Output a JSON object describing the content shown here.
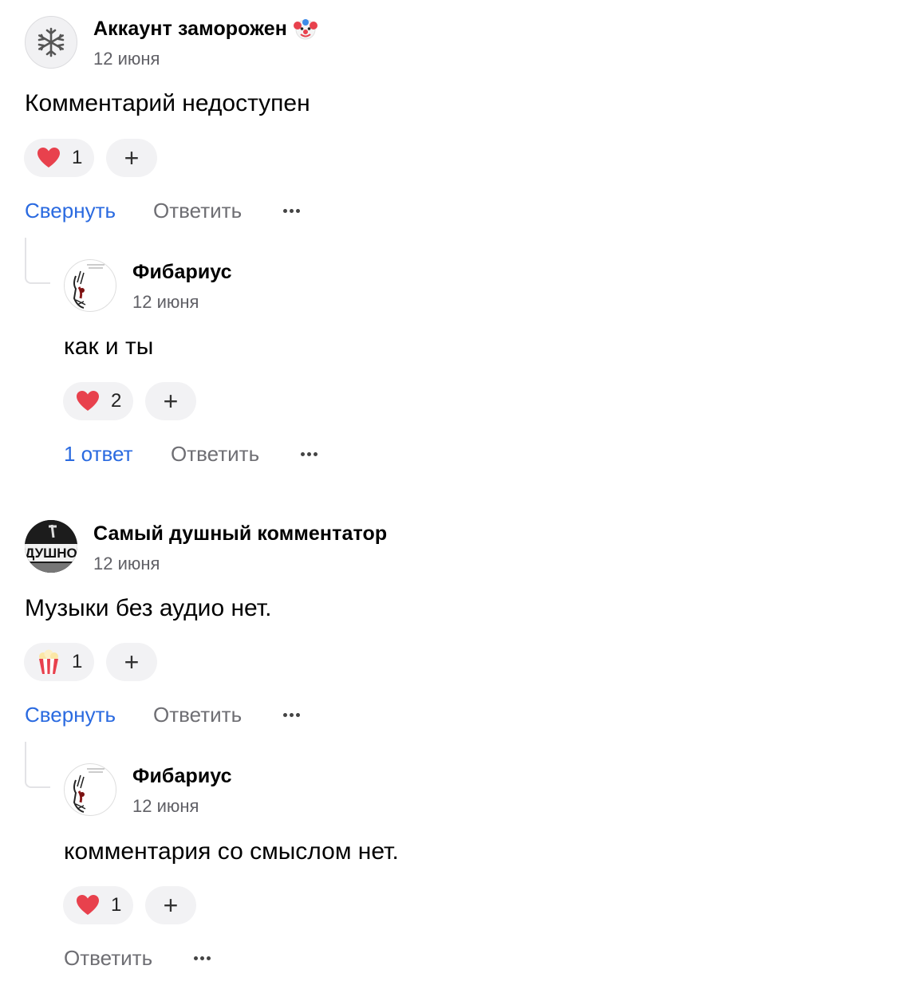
{
  "comments": [
    {
      "author": "Аккаунт заморожен",
      "date": "12 июня",
      "text": "Комментарий недоступен",
      "reaction_count": "1",
      "add_label": "+",
      "collapse_label": "Свернуть",
      "reply_label": "Ответить",
      "reply": {
        "author": "Фибариус",
        "date": "12 июня",
        "text": "как и ты",
        "reaction_count": "2",
        "add_label": "+",
        "replies_label": "1 ответ",
        "reply_label": "Ответить"
      }
    },
    {
      "author": "Самый душный комментатор",
      "date": "12 июня",
      "text": "Музыки без аудио нет.",
      "reaction_count": "1",
      "add_label": "+",
      "collapse_label": "Свернуть",
      "reply_label": "Ответить",
      "avatar_text": "ДУШНО",
      "reply": {
        "author": "Фибариус",
        "date": "12 июня",
        "text": "комментария со смыслом нет.",
        "reaction_count": "1",
        "add_label": "+",
        "reply_label": "Ответить"
      }
    }
  ],
  "colors": {
    "link": "#2a6ae0",
    "muted": "#6e6e73",
    "pill": "#f2f2f4",
    "heart": "#e8414d"
  }
}
